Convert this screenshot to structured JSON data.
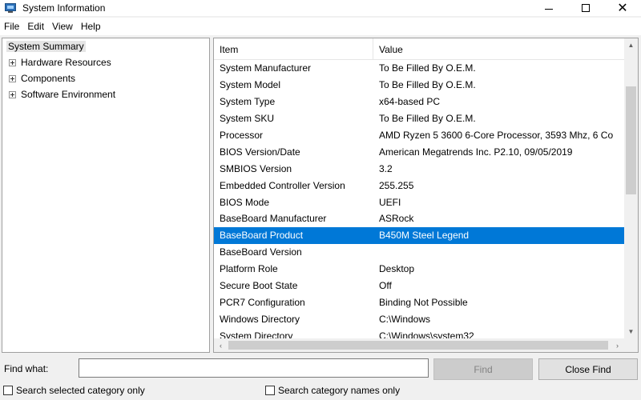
{
  "window": {
    "title": "System Information"
  },
  "menu": [
    "File",
    "Edit",
    "View",
    "Help"
  ],
  "tree": {
    "root": "System Summary",
    "children": [
      "Hardware Resources",
      "Components",
      "Software Environment"
    ]
  },
  "list": {
    "columns": {
      "item": "Item",
      "value": "Value"
    },
    "rows": [
      {
        "item": "System Manufacturer",
        "value": "To Be Filled By O.E.M."
      },
      {
        "item": "System Model",
        "value": "To Be Filled By O.E.M."
      },
      {
        "item": "System Type",
        "value": "x64-based PC"
      },
      {
        "item": "System SKU",
        "value": "To Be Filled By O.E.M."
      },
      {
        "item": "Processor",
        "value": "AMD Ryzen 5 3600 6-Core Processor, 3593 Mhz, 6 Co"
      },
      {
        "item": "BIOS Version/Date",
        "value": "American Megatrends Inc. P2.10, 09/05/2019"
      },
      {
        "item": "SMBIOS Version",
        "value": "3.2"
      },
      {
        "item": "Embedded Controller Version",
        "value": "255.255"
      },
      {
        "item": "BIOS Mode",
        "value": "UEFI"
      },
      {
        "item": "BaseBoard Manufacturer",
        "value": "ASRock"
      },
      {
        "item": "BaseBoard Product",
        "value": "B450M Steel Legend"
      },
      {
        "item": "BaseBoard Version",
        "value": ""
      },
      {
        "item": "Platform Role",
        "value": "Desktop"
      },
      {
        "item": "Secure Boot State",
        "value": "Off"
      },
      {
        "item": "PCR7 Configuration",
        "value": "Binding Not Possible"
      },
      {
        "item": "Windows Directory",
        "value": "C:\\Windows"
      },
      {
        "item": "System Directory",
        "value": "C:\\Windows\\system32"
      }
    ],
    "selected_row": "BaseBoard Product"
  },
  "find": {
    "label": "Find what:",
    "value": "",
    "find_button": "Find",
    "close_button": "Close Find",
    "search_selected_label": "Search selected category only",
    "search_names_label": "Search category names only"
  },
  "colors": {
    "selection": "#0078d7"
  }
}
